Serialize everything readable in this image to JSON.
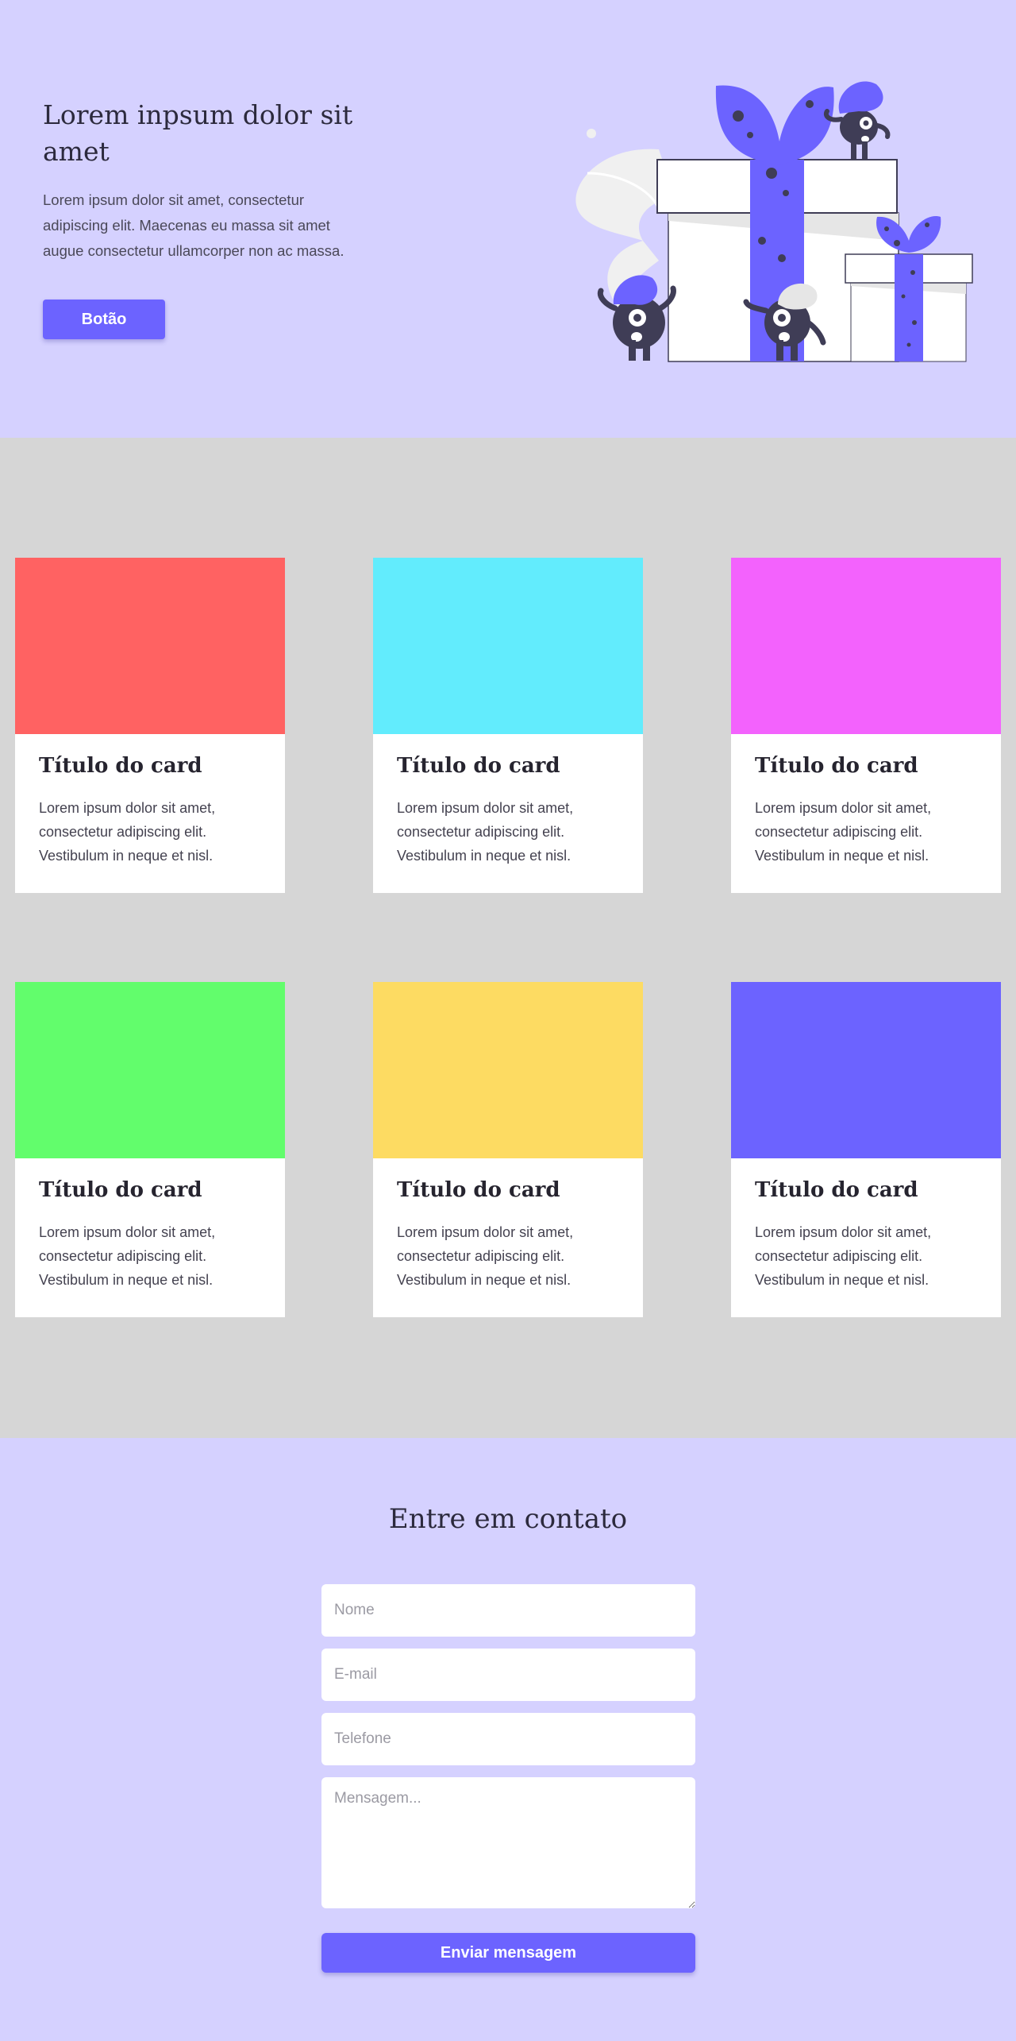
{
  "hero": {
    "title": "Lorem inpsum dolor sit amet",
    "body": "Lorem ipsum dolor sit amet, consectetur adipiscing elit. Maecenas eu massa sit amet augue consectetur ullamcorper non ac massa.",
    "button_label": "Botão",
    "illustration": "gift-boxes-with-monsters-illustration"
  },
  "cards": [
    {
      "title": "Título do card",
      "body": "Lorem ipsum dolor sit amet, consectetur adipiscing elit. Vestibulum in neque et nisl.",
      "color": "#ff6262"
    },
    {
      "title": "Título do card",
      "body": "Lorem ipsum dolor sit amet, consectetur adipiscing elit. Vestibulum in neque et nisl.",
      "color": "#62ecfd"
    },
    {
      "title": "Título do card",
      "body": "Lorem ipsum dolor sit amet, consectetur adipiscing elit. Vestibulum in neque et nisl.",
      "color": "#f362fd"
    },
    {
      "title": "Título do card",
      "body": "Lorem ipsum dolor sit amet, consectetur adipiscing elit. Vestibulum in neque et nisl.",
      "color": "#62fd6c"
    },
    {
      "title": "Título do card",
      "body": "Lorem ipsum dolor sit amet, consectetur adipiscing elit. Vestibulum in neque et nisl.",
      "color": "#fddb62"
    },
    {
      "title": "Título do card",
      "body": "Lorem ipsum dolor sit amet, consectetur adipiscing elit. Vestibulum in neque et nisl.",
      "color": "#6c63ff"
    }
  ],
  "contact": {
    "title": "Entre em contato",
    "name_placeholder": "Nome",
    "email_placeholder": "E-mail",
    "phone_placeholder": "Telefone",
    "message_placeholder": "Mensagem...",
    "submit_label": "Enviar mensagem"
  },
  "colors": {
    "accent": "#6c63ff",
    "hero_background": "#d5d1ff",
    "cards_background": "#d6d6d6"
  }
}
